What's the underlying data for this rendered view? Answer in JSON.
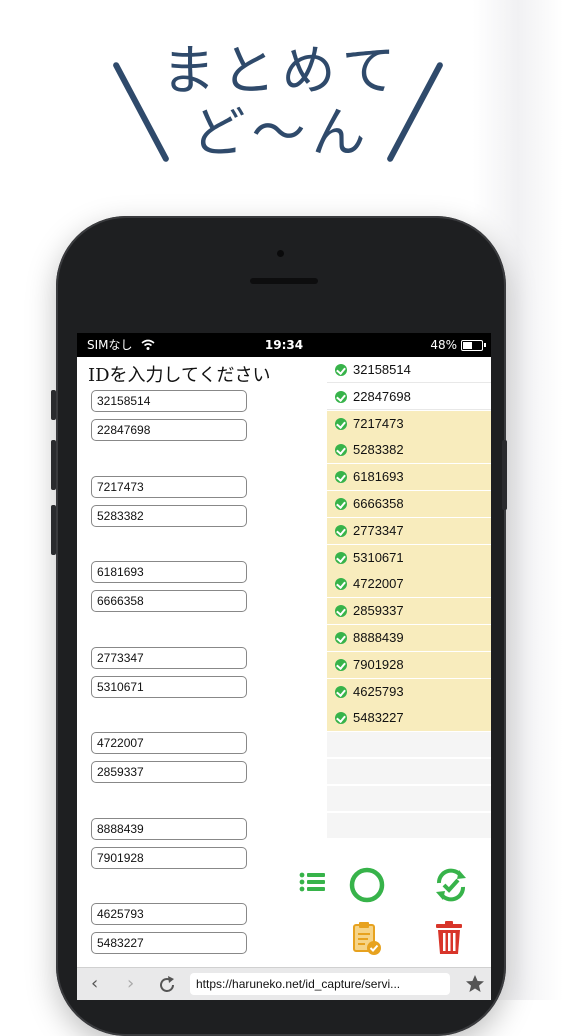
{
  "headline": {
    "line1": "まとめて",
    "line2": "ど〜ん"
  },
  "status_bar": {
    "carrier": "SIMなし",
    "time": "19:34",
    "battery": "48%",
    "battery_level": 0.48
  },
  "left_panel": {
    "prompt": "IDを入力してください",
    "inputs": [
      "32158514",
      "22847698",
      "7217473",
      "5283382",
      "6181693",
      "6666358",
      "2773347",
      "5310671",
      "4722007",
      "2859337",
      "8888439",
      "7901928",
      "4625793",
      "5483227"
    ]
  },
  "right_panel": {
    "ids": [
      "32158514",
      "22847698",
      "7217473",
      "5283382",
      "6181693",
      "6666358",
      "2773347",
      "5310671",
      "4722007",
      "2859337",
      "8888439",
      "7901928",
      "4625793",
      "5483227"
    ]
  },
  "actions": {
    "list_icon": "list-icon",
    "circle_icon": "circle-icon",
    "sync_check_icon": "sync-check-icon",
    "clipboard_check_icon": "clipboard-check-icon",
    "trash_icon": "trash-icon"
  },
  "browser": {
    "url": "https://haruneko.net/id_capture/servi...",
    "back": "‹",
    "forward": "›"
  },
  "colors": {
    "heading": "#2f4a6b",
    "highlight": "#f8ecbd",
    "check_green": "#37b34a",
    "trash_red": "#d8352a",
    "clipboard_orange": "#e7a21f"
  }
}
